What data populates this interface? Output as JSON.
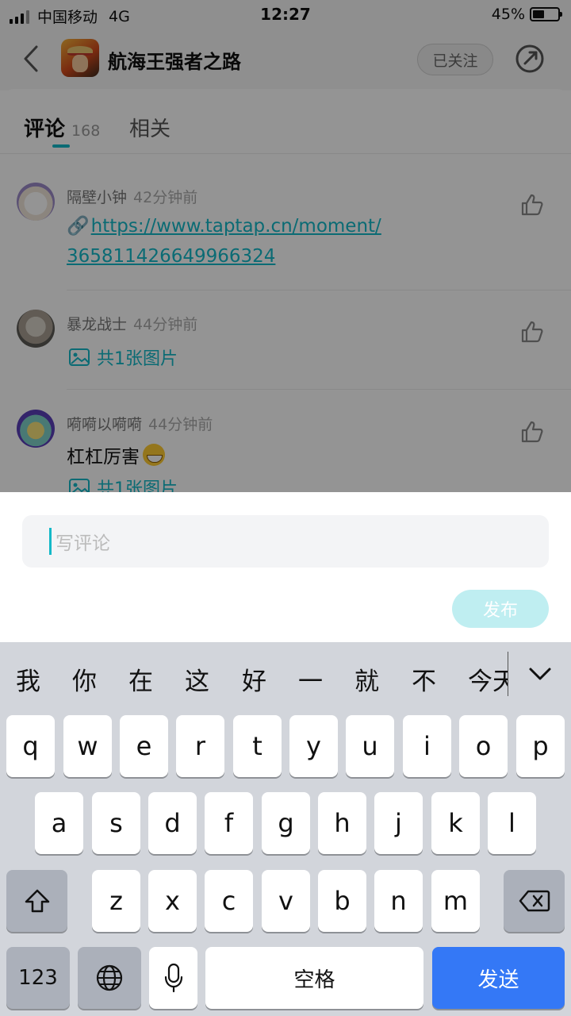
{
  "status_bar": {
    "carrier": "中国移动",
    "network": "4G",
    "time": "12:27",
    "battery_text": "45%",
    "battery_level": 0.45
  },
  "header": {
    "title": "航海王强者之路",
    "follow_label": "已关注"
  },
  "tabs": {
    "comments_label": "评论",
    "comments_count": "168",
    "related_label": "相关"
  },
  "comments": [
    {
      "user": "隔壁小钟",
      "time": "42分钟前",
      "link_line1": "https://www.taptap.cn/moment/",
      "link_line2": "365811426649966324"
    },
    {
      "user": "暴龙战士",
      "time": "44分钟前",
      "images_label": "共1张图片"
    },
    {
      "user": "嗬嗬以嗬嗬",
      "time": "44分钟前",
      "text": "杠杠厉害",
      "images_label": "共1张图片"
    }
  ],
  "composer": {
    "placeholder": "写评论",
    "publish_label": "发布"
  },
  "keyboard": {
    "candidates": [
      "我",
      "你",
      "在",
      "这",
      "好",
      "一",
      "就",
      "不",
      "今天"
    ],
    "row1": [
      "q",
      "w",
      "e",
      "r",
      "t",
      "y",
      "u",
      "i",
      "o",
      "p"
    ],
    "row2": [
      "a",
      "s",
      "d",
      "f",
      "g",
      "h",
      "j",
      "k",
      "l"
    ],
    "row3": [
      "z",
      "x",
      "c",
      "v",
      "b",
      "n",
      "m"
    ],
    "num_label": "123",
    "space_label": "空格",
    "send_label": "发送"
  },
  "colors": {
    "accent": "#14b9c8",
    "send_key": "#3478f6",
    "publish_disabled": "#bfeef1"
  },
  "icons": [
    "back-icon",
    "share-icon",
    "like-icon",
    "link-icon",
    "image-icon",
    "chevron-down-icon",
    "shift-icon",
    "delete-icon",
    "globe-icon",
    "mic-icon"
  ]
}
